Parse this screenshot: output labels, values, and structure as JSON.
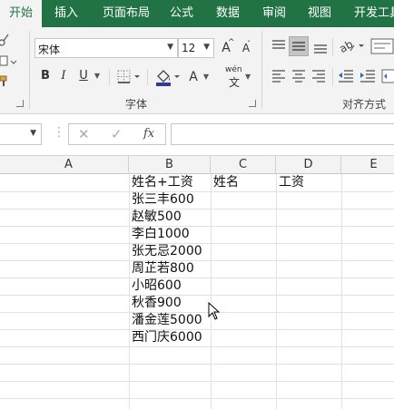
{
  "tabs": [
    {
      "label": "开始",
      "active": true
    },
    {
      "label": "插入"
    },
    {
      "label": "页面布局"
    },
    {
      "label": "公式"
    },
    {
      "label": "数据"
    },
    {
      "label": "审阅"
    },
    {
      "label": "视图"
    },
    {
      "label": "开发工具"
    }
  ],
  "font_group": {
    "font_name": "宋体",
    "font_size": "12",
    "grow_label": "A",
    "shrink_label": "A",
    "bold_label": "B",
    "italic_label": "I",
    "underline_label": "U",
    "font_color_label": "A",
    "phonetic_label": "wén",
    "phonetic_sub": "文",
    "label": "字体"
  },
  "alignment_group": {
    "label": "对齐方式"
  },
  "formula_bar": {
    "name_box": "",
    "fx_label": "fx",
    "formula": ""
  },
  "columns": [
    "A",
    "B",
    "C",
    "D",
    "E"
  ],
  "cells": {
    "B": [
      "姓名+工资",
      "张三丰600",
      "赵敏500",
      "李白1000",
      "张无忌2000",
      "周芷若800",
      "小昭600",
      "秋香900",
      "潘金莲5000",
      "西门庆6000"
    ],
    "C1": "姓名",
    "D1": "工资"
  },
  "colors": {
    "accent": "#217346",
    "ribbon_bg": "#f3f3f3",
    "gridline": "#e2e2e2"
  }
}
